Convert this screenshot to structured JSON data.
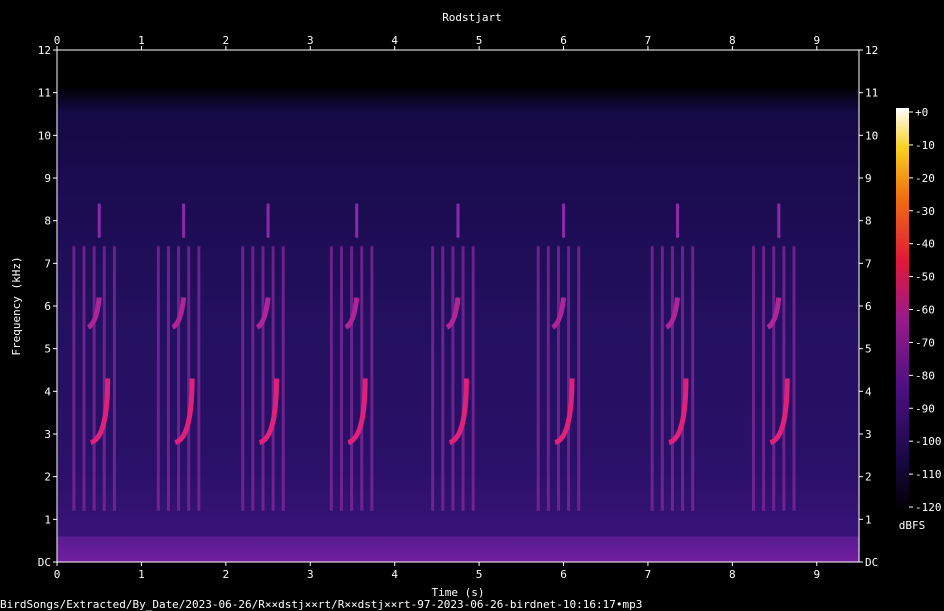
{
  "chart_data": {
    "type": "heatmap",
    "title": "Rodstjart",
    "xlabel": "Time (s)",
    "ylabel": "Frequency (kHz)",
    "x_ticks": [
      "0",
      "1",
      "2",
      "3",
      "4",
      "5",
      "6",
      "7",
      "8",
      "9"
    ],
    "y_ticks": [
      "DC",
      "1",
      "2",
      "3",
      "4",
      "5",
      "6",
      "7",
      "8",
      "9",
      "10",
      "11",
      "12"
    ],
    "xlim": [
      0,
      9.5
    ],
    "ylim": [
      0,
      12
    ],
    "colorbar": {
      "label": "dBFS",
      "ticks": [
        "+0",
        "-10",
        "-20",
        "-30",
        "-40",
        "-50",
        "-60",
        "-70",
        "-80",
        "-90",
        "-100",
        "-110",
        "-120"
      ],
      "range": [
        -120,
        0
      ]
    },
    "song_onsets_s": [
      0.45,
      1.45,
      2.45,
      3.5,
      4.7,
      5.95,
      7.3,
      8.5
    ],
    "song_band_khz": [
      2.7,
      5.7
    ]
  },
  "footer": {
    "filepath": "BirdSongs/Extracted/By_Date/2023-06-26/R××dstj××rt/R××dstj××rt-97-2023-06-26-birdnet-10:16:17•mp3"
  }
}
